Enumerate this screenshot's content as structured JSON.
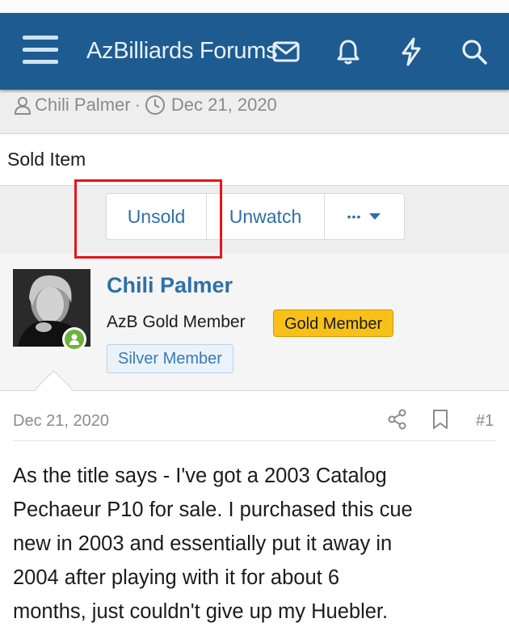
{
  "nav": {
    "brand": "AzBilliards Forums",
    "icons": [
      "menu-icon",
      "envelope-icon",
      "bell-icon",
      "lightning-icon",
      "search-icon"
    ]
  },
  "thread_meta": {
    "author": "Chili Palmer",
    "separator": "·",
    "date": "Dec 21, 2020"
  },
  "prefix": {
    "label": "Sold Item"
  },
  "actions": {
    "unsold": "Unsold",
    "unwatch": "Unwatch",
    "more": "•••"
  },
  "post": {
    "username": "Chili Palmer",
    "user_title": "AzB Gold Member",
    "badges": [
      "Gold Member",
      "Silver Member"
    ],
    "date": "Dec 21, 2020",
    "number": "#1",
    "body_lines": [
      "As the title says - I've got a 2003 Catalog",
      "Pechaeur P10 for sale. I purchased this cue",
      "new in 2003 and essentially put it away in",
      "2004 after playing with it for about 6",
      "months, just couldn't give up my Huebler."
    ]
  },
  "colors": {
    "nav_bg": "#1e5b90",
    "link": "#2f6fa7",
    "gold_badge": "#f7c11a",
    "online": "#6bb33c",
    "highlight_box": "#e4141c"
  }
}
